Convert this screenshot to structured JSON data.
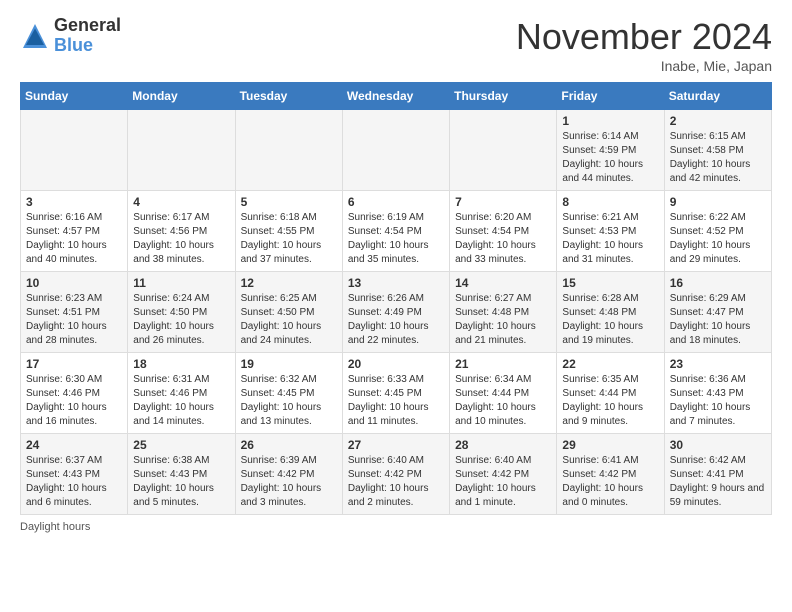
{
  "header": {
    "logo_general": "General",
    "logo_blue": "Blue",
    "month_title": "November 2024",
    "location": "Inabe, Mie, Japan"
  },
  "weekdays": [
    "Sunday",
    "Monday",
    "Tuesday",
    "Wednesday",
    "Thursday",
    "Friday",
    "Saturday"
  ],
  "weeks": [
    [
      {
        "day": "",
        "info": ""
      },
      {
        "day": "",
        "info": ""
      },
      {
        "day": "",
        "info": ""
      },
      {
        "day": "",
        "info": ""
      },
      {
        "day": "",
        "info": ""
      },
      {
        "day": "1",
        "info": "Sunrise: 6:14 AM\nSunset: 4:59 PM\nDaylight: 10 hours and 44 minutes."
      },
      {
        "day": "2",
        "info": "Sunrise: 6:15 AM\nSunset: 4:58 PM\nDaylight: 10 hours and 42 minutes."
      }
    ],
    [
      {
        "day": "3",
        "info": "Sunrise: 6:16 AM\nSunset: 4:57 PM\nDaylight: 10 hours and 40 minutes."
      },
      {
        "day": "4",
        "info": "Sunrise: 6:17 AM\nSunset: 4:56 PM\nDaylight: 10 hours and 38 minutes."
      },
      {
        "day": "5",
        "info": "Sunrise: 6:18 AM\nSunset: 4:55 PM\nDaylight: 10 hours and 37 minutes."
      },
      {
        "day": "6",
        "info": "Sunrise: 6:19 AM\nSunset: 4:54 PM\nDaylight: 10 hours and 35 minutes."
      },
      {
        "day": "7",
        "info": "Sunrise: 6:20 AM\nSunset: 4:54 PM\nDaylight: 10 hours and 33 minutes."
      },
      {
        "day": "8",
        "info": "Sunrise: 6:21 AM\nSunset: 4:53 PM\nDaylight: 10 hours and 31 minutes."
      },
      {
        "day": "9",
        "info": "Sunrise: 6:22 AM\nSunset: 4:52 PM\nDaylight: 10 hours and 29 minutes."
      }
    ],
    [
      {
        "day": "10",
        "info": "Sunrise: 6:23 AM\nSunset: 4:51 PM\nDaylight: 10 hours and 28 minutes."
      },
      {
        "day": "11",
        "info": "Sunrise: 6:24 AM\nSunset: 4:50 PM\nDaylight: 10 hours and 26 minutes."
      },
      {
        "day": "12",
        "info": "Sunrise: 6:25 AM\nSunset: 4:50 PM\nDaylight: 10 hours and 24 minutes."
      },
      {
        "day": "13",
        "info": "Sunrise: 6:26 AM\nSunset: 4:49 PM\nDaylight: 10 hours and 22 minutes."
      },
      {
        "day": "14",
        "info": "Sunrise: 6:27 AM\nSunset: 4:48 PM\nDaylight: 10 hours and 21 minutes."
      },
      {
        "day": "15",
        "info": "Sunrise: 6:28 AM\nSunset: 4:48 PM\nDaylight: 10 hours and 19 minutes."
      },
      {
        "day": "16",
        "info": "Sunrise: 6:29 AM\nSunset: 4:47 PM\nDaylight: 10 hours and 18 minutes."
      }
    ],
    [
      {
        "day": "17",
        "info": "Sunrise: 6:30 AM\nSunset: 4:46 PM\nDaylight: 10 hours and 16 minutes."
      },
      {
        "day": "18",
        "info": "Sunrise: 6:31 AM\nSunset: 4:46 PM\nDaylight: 10 hours and 14 minutes."
      },
      {
        "day": "19",
        "info": "Sunrise: 6:32 AM\nSunset: 4:45 PM\nDaylight: 10 hours and 13 minutes."
      },
      {
        "day": "20",
        "info": "Sunrise: 6:33 AM\nSunset: 4:45 PM\nDaylight: 10 hours and 11 minutes."
      },
      {
        "day": "21",
        "info": "Sunrise: 6:34 AM\nSunset: 4:44 PM\nDaylight: 10 hours and 10 minutes."
      },
      {
        "day": "22",
        "info": "Sunrise: 6:35 AM\nSunset: 4:44 PM\nDaylight: 10 hours and 9 minutes."
      },
      {
        "day": "23",
        "info": "Sunrise: 6:36 AM\nSunset: 4:43 PM\nDaylight: 10 hours and 7 minutes."
      }
    ],
    [
      {
        "day": "24",
        "info": "Sunrise: 6:37 AM\nSunset: 4:43 PM\nDaylight: 10 hours and 6 minutes."
      },
      {
        "day": "25",
        "info": "Sunrise: 6:38 AM\nSunset: 4:43 PM\nDaylight: 10 hours and 5 minutes."
      },
      {
        "day": "26",
        "info": "Sunrise: 6:39 AM\nSunset: 4:42 PM\nDaylight: 10 hours and 3 minutes."
      },
      {
        "day": "27",
        "info": "Sunrise: 6:40 AM\nSunset: 4:42 PM\nDaylight: 10 hours and 2 minutes."
      },
      {
        "day": "28",
        "info": "Sunrise: 6:40 AM\nSunset: 4:42 PM\nDaylight: 10 hours and 1 minute."
      },
      {
        "day": "29",
        "info": "Sunrise: 6:41 AM\nSunset: 4:42 PM\nDaylight: 10 hours and 0 minutes."
      },
      {
        "day": "30",
        "info": "Sunrise: 6:42 AM\nSunset: 4:41 PM\nDaylight: 9 hours and 59 minutes."
      }
    ]
  ],
  "footer": {
    "note": "Daylight hours"
  }
}
